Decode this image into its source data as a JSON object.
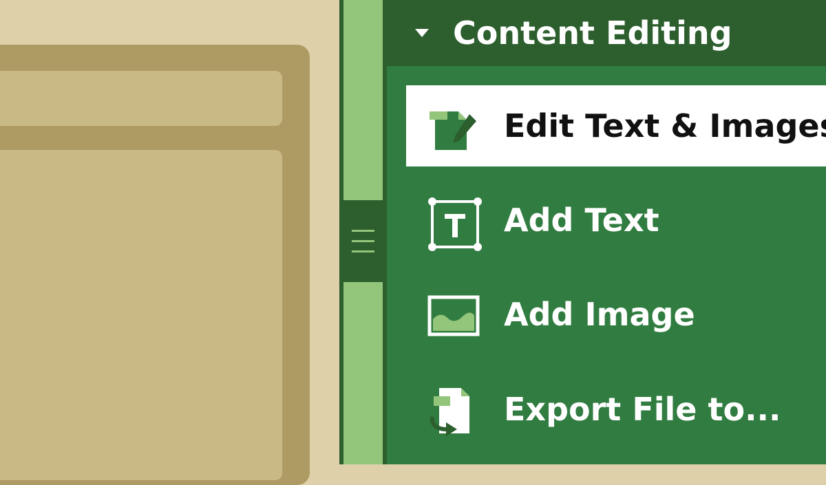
{
  "panel": {
    "title": "Content Editing",
    "expanded": true
  },
  "tools": [
    {
      "label": "Edit Text & Images",
      "icon": "edit-document-icon",
      "selected": true
    },
    {
      "label": "Add Text",
      "icon": "text-box-icon",
      "selected": false
    },
    {
      "label": "Add Image",
      "icon": "image-icon",
      "selected": false
    },
    {
      "label": "Export File to...",
      "icon": "export-file-icon",
      "selected": false
    }
  ],
  "colors": {
    "panel_dark": "#2c5e2e",
    "panel_green": "#317c40",
    "accent_light_green": "#93c57b",
    "document_bg": "#ded1a9",
    "document_frame": "#ae9a63",
    "document_panel": "#c8b985"
  }
}
